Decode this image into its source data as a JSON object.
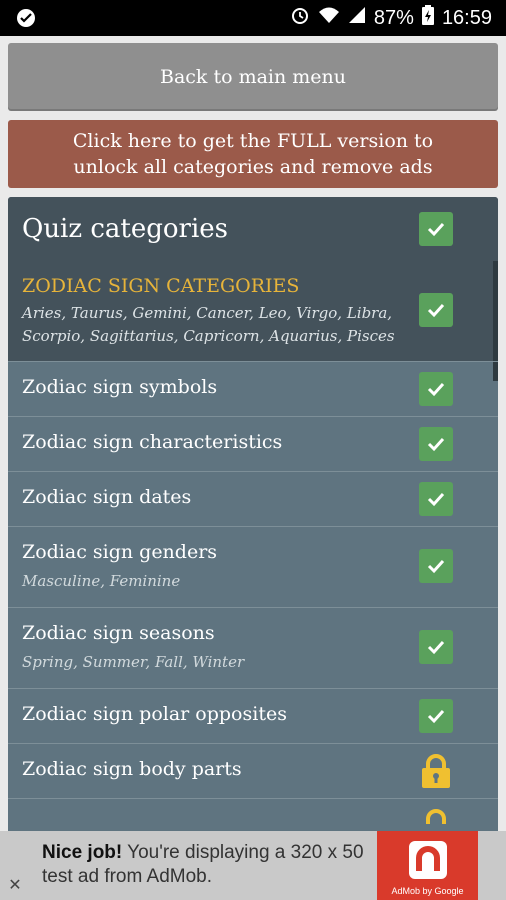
{
  "status": {
    "battery": "87%",
    "time": "16:59"
  },
  "menu": {
    "back_label": "Back to main menu",
    "full_line1": "Click here to get the FULL version to",
    "full_line2": "unlock all categories and remove ads"
  },
  "quiz": {
    "title": "Quiz categories",
    "group_title": "ZODIAC SIGN CATEGORIES",
    "group_desc": "Aries, Taurus, Gemini, Cancer, Leo, Virgo, Libra, Scorpio, Sagittarius, Capricorn, Aquarius, Pisces",
    "items": [
      {
        "label": "Zodiac sign symbols",
        "sub": "",
        "state": "checked"
      },
      {
        "label": "Zodiac sign characteristics",
        "sub": "",
        "state": "checked"
      },
      {
        "label": "Zodiac sign dates",
        "sub": "",
        "state": "checked"
      },
      {
        "label": "Zodiac sign genders",
        "sub": "Masculine, Feminine",
        "state": "checked"
      },
      {
        "label": "Zodiac sign seasons",
        "sub": "Spring, Summer, Fall, Winter",
        "state": "checked"
      },
      {
        "label": "Zodiac sign polar opposites",
        "sub": "",
        "state": "checked"
      },
      {
        "label": "Zodiac sign body parts",
        "sub": "",
        "state": "locked"
      }
    ]
  },
  "ad": {
    "bold": "Nice job!",
    "text": " You're displaying a 320 x 50 test ad from AdMob.",
    "logo_caption": "AdMob by Google"
  },
  "colors": {
    "check_green": "#5aa15c",
    "lock_yellow": "#f0c030",
    "header_accent": "#e7b43a"
  }
}
